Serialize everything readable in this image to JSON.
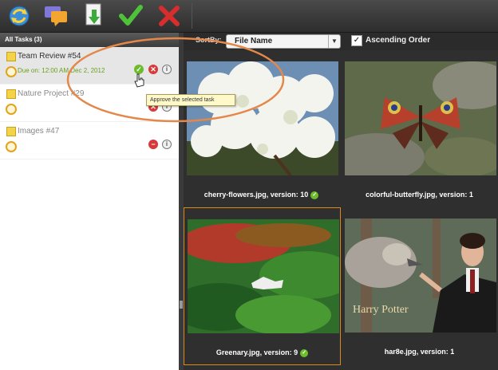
{
  "toolbar": {
    "icons": [
      "refresh-icon",
      "comments-icon",
      "download-icon",
      "approve-check-icon",
      "reject-x-icon"
    ]
  },
  "tasks_panel": {
    "header": "All Tasks (3)",
    "tasks": [
      {
        "title": "Team Review #54",
        "due": "Due on: 12:00 AM Dec 2, 2012"
      },
      {
        "title": "Nature Project #29",
        "due": ""
      },
      {
        "title": "Images #47",
        "due": ""
      }
    ],
    "tooltip": "Approve the selected task"
  },
  "sort": {
    "label": "SortBy:",
    "value": "File Name",
    "ascending_label": "Ascending Order",
    "ascending_checked": true
  },
  "files": [
    {
      "caption": "cherry-flowers.jpg, version: 10",
      "approved": true
    },
    {
      "caption": "colorful-butterfly.jpg, version: 1",
      "approved": false
    },
    {
      "caption": "Greenary.jpg, version: 9",
      "approved": true
    },
    {
      "caption": "har8e.jpg, version: 1",
      "approved": false
    }
  ],
  "colors": {
    "accent_orange": "#e4874a",
    "approve_green": "#6cbc2c",
    "reject_red": "#d73a3a"
  }
}
